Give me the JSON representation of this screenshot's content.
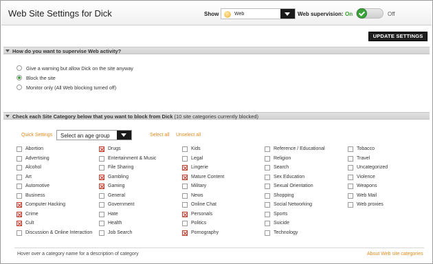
{
  "header": {
    "title": "Web Site Settings for Dick",
    "show_label": "Show",
    "show_value": "Web",
    "supervision_label": "Web supervision:",
    "on_label": "On",
    "off_label": "Off"
  },
  "toolbar": {
    "update_label": "UPDATE SETTINGS"
  },
  "supervise": {
    "title": "How do you want to supervise Web activity?",
    "options": [
      {
        "label": "Give a warning but allow Dick on the site anyway",
        "selected": false
      },
      {
        "label": "Block the site",
        "selected": true
      },
      {
        "label": "Monitor only (All Web blocking turned off)",
        "selected": false
      }
    ]
  },
  "categories_section": {
    "title": "Check each Site Category below that you want to block from Dick",
    "note": "(10 site categories currently blocked)",
    "quick_settings_label": "Quick Settings",
    "age_placeholder": "Select an age group",
    "select_all": "Select all",
    "unselect_all": "Unselect all",
    "hint": "Hover over a category name for a description of category",
    "about_link": "About Web site categories"
  },
  "categories": [
    [
      {
        "label": "Abortion",
        "blocked": false
      },
      {
        "label": "Advertising",
        "blocked": false
      },
      {
        "label": "Alcohol",
        "blocked": false
      },
      {
        "label": "Art",
        "blocked": false
      },
      {
        "label": "Automotive",
        "blocked": false
      },
      {
        "label": "Business",
        "blocked": false
      },
      {
        "label": "Computer Hacking",
        "blocked": true
      },
      {
        "label": "Crime",
        "blocked": true
      },
      {
        "label": "Cult",
        "blocked": true
      },
      {
        "label": "Discussion & Online Interaction",
        "blocked": false
      }
    ],
    [
      {
        "label": "Drugs",
        "blocked": true
      },
      {
        "label": "Entertainment & Music",
        "blocked": false
      },
      {
        "label": "File Sharing",
        "blocked": false
      },
      {
        "label": "Gambling",
        "blocked": true
      },
      {
        "label": "Gaming",
        "blocked": true
      },
      {
        "label": "General",
        "blocked": false
      },
      {
        "label": "Government",
        "blocked": false
      },
      {
        "label": "Hate",
        "blocked": false
      },
      {
        "label": "Health",
        "blocked": false
      },
      {
        "label": "Job Search",
        "blocked": false
      }
    ],
    [
      {
        "label": "Kids",
        "blocked": false
      },
      {
        "label": "Legal",
        "blocked": false
      },
      {
        "label": "Lingerie",
        "blocked": true
      },
      {
        "label": "Mature Content",
        "blocked": true
      },
      {
        "label": "Military",
        "blocked": false
      },
      {
        "label": "News",
        "blocked": false
      },
      {
        "label": "Online Chat",
        "blocked": false
      },
      {
        "label": "Personals",
        "blocked": true
      },
      {
        "label": "Politics",
        "blocked": false
      },
      {
        "label": "Pornography",
        "blocked": true
      }
    ],
    [
      {
        "label": "Reference / Educational",
        "blocked": false
      },
      {
        "label": "Religion",
        "blocked": false
      },
      {
        "label": "Search",
        "blocked": false
      },
      {
        "label": "Sex Education",
        "blocked": false
      },
      {
        "label": "Sexual Orientation",
        "blocked": false
      },
      {
        "label": "Shopping",
        "blocked": false
      },
      {
        "label": "Social Networking",
        "blocked": false
      },
      {
        "label": "Sports",
        "blocked": false
      },
      {
        "label": "Suicide",
        "blocked": false
      },
      {
        "label": "Technology",
        "blocked": false
      }
    ],
    [
      {
        "label": "Tobacco",
        "blocked": false
      },
      {
        "label": "Travel",
        "blocked": false
      },
      {
        "label": "Uncategorized",
        "blocked": false
      },
      {
        "label": "Violence",
        "blocked": false
      },
      {
        "label": "Weapons",
        "blocked": false
      },
      {
        "label": "Web Mail",
        "blocked": false
      },
      {
        "label": "Web proxies",
        "blocked": false
      }
    ]
  ],
  "colors": {
    "accent": "#e08a1e",
    "on_green": "#3aa33a",
    "blocked_red": "#c0392b"
  },
  "icons": {
    "show_value": "globe-icon",
    "blocked_mark": "red-x-icon",
    "toggle_knob": "checkmark-icon"
  }
}
